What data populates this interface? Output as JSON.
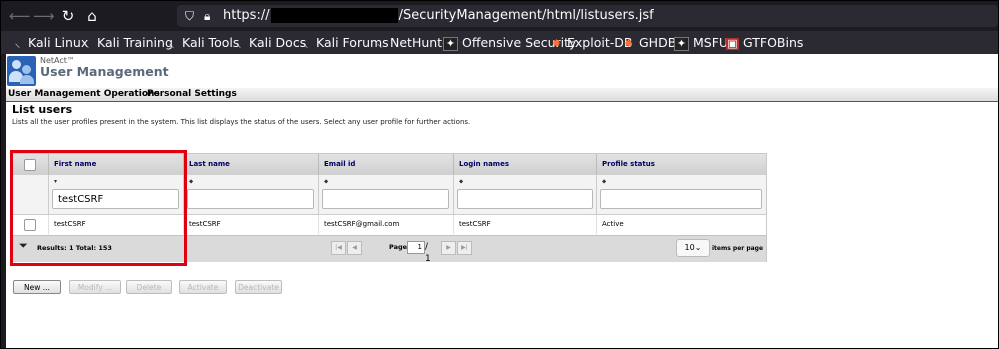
{
  "browser": {
    "url_prefix": "https://",
    "url_path": "/SecurityManagement/html/listusers.jsf",
    "bookmarks": [
      "Kali Linux",
      "Kali Training",
      "Kali Tools",
      "Kali Docs",
      "Kali Forums",
      "NetHunter",
      "Offensive Security",
      "Exploit-DB",
      "GHDB",
      "MSFU",
      "GTFOBins"
    ]
  },
  "app": {
    "brand": "NetAct™",
    "title": "User Management",
    "menu": [
      "User Management Operations",
      "Personal Settings"
    ]
  },
  "page": {
    "title": "List users",
    "description": "Lists all the user profiles present in the system. This list displays the status of the users. Select any user profile for further actions."
  },
  "table": {
    "columns": [
      "First name",
      "Last name",
      "Email id",
      "Login names",
      "Profile status"
    ],
    "sort_icons": [
      "▾",
      "⬥",
      "⬥",
      "⬥",
      "⬥"
    ],
    "filters": [
      "testCSRF",
      "",
      "",
      "",
      ""
    ],
    "rows": [
      [
        "testCSRF",
        "testCSRF",
        "testCSRF@gmail.com",
        "testCSRF",
        "Active"
      ]
    ],
    "footer": {
      "results": "Results: 1   Total: 153",
      "page_label": "Page",
      "page_value": "1",
      "page_total": "/ 1",
      "per_page": "10",
      "per_page_label": "items per page"
    }
  },
  "buttons": [
    "New ...",
    "Modify ...",
    "Delete",
    "Activate",
    "Deactivate"
  ]
}
